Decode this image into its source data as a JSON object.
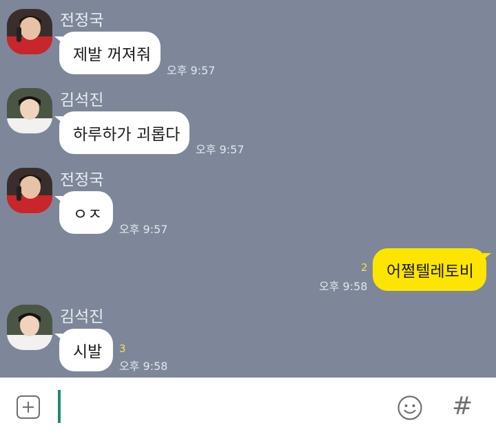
{
  "messages": [
    {
      "sender": "전정국",
      "text": "제발 꺼져줘",
      "time": "오후 9:57"
    },
    {
      "sender": "김석진",
      "text": "하루하가 괴롭다",
      "time": "오후 9:57"
    },
    {
      "sender": "전정국",
      "text": "ㅇㅈ",
      "time": "오후 9:57"
    },
    {
      "sender": "",
      "text": "어쩔텔레토비",
      "time": "오후 9:58",
      "unread": "2"
    },
    {
      "sender": "김석진",
      "text": "시발",
      "time": "오후 9:58",
      "unread": "3"
    }
  ],
  "input": {
    "value": "",
    "placeholder": ""
  },
  "icons": {
    "attach": "plus-square-icon",
    "emoji": "smiley-icon",
    "search": "hash-icon"
  },
  "toolbar": {
    "hash_label": "#"
  },
  "colors": {
    "chat_background": "#7d8799",
    "incoming_bubble": "#ffffff",
    "outgoing_bubble": "#fee500",
    "unread_count": "#f5e44a",
    "caret": "#1b8a72"
  }
}
